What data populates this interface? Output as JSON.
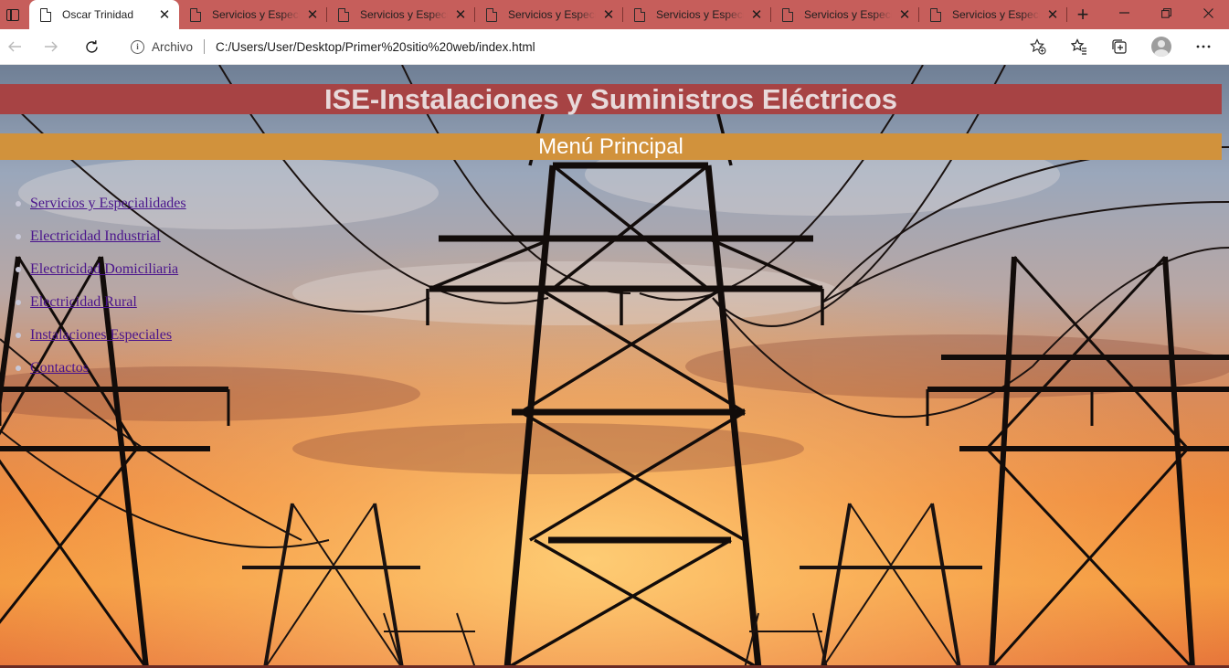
{
  "browser": {
    "tabs": [
      {
        "title": "Oscar Trinidad",
        "active": true
      },
      {
        "title": "Servicios y Especialidades",
        "active": false
      },
      {
        "title": "Servicios y Especialidades",
        "active": false
      },
      {
        "title": "Servicios y Especialidades",
        "active": false
      },
      {
        "title": "Servicios y Especialidades",
        "active": false
      },
      {
        "title": "Servicios y Especialidades",
        "active": false
      },
      {
        "title": "Servicios y Especialidades",
        "active": false
      }
    ],
    "close_glyph": "✕",
    "new_tab_glyph": "+",
    "address": {
      "scheme_label": "Archivo",
      "url": "C:/Users/User/Desktop/Primer%20sitio%20web/index.html"
    },
    "colors": {
      "tab_strip": "#c65e5b",
      "active_tab": "#ffffff"
    }
  },
  "page": {
    "site_title": "ISE-Instalaciones y Suministros Eléctricos",
    "menu_title": "Menú Principal",
    "menu_items": [
      "Servicios y Especialidades",
      "Electricidad Industrial",
      "Electricidad Domiciliaria",
      "Electricidad Rural",
      "Instalaciones Especiales",
      "Contactos"
    ],
    "colors": {
      "title_bar": "#a74344",
      "menu_bar": "#d1923c",
      "link": "#4a148c"
    }
  }
}
